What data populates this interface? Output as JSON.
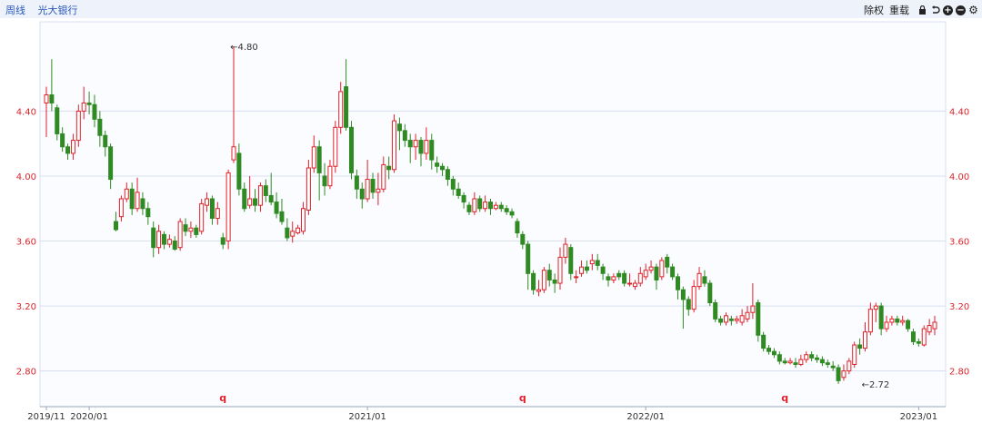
{
  "toolbar": {
    "period": "周线",
    "stock_name": "光大银行",
    "adjust": "除权",
    "overlay": "重载",
    "icons": [
      "lock-icon",
      "undo-icon",
      "zoom-in-icon",
      "zoom-out-icon",
      "gear-icon"
    ]
  },
  "colors": {
    "up": "#e0202a",
    "down": "#2f8a22",
    "grid": "#d7dff0",
    "axis_text": "#d9262c",
    "bg": "#ffffff",
    "plot_bg": "#fbfcff"
  },
  "chart_data": {
    "type": "candlestick",
    "ylim": [
      2.58,
      4.95
    ],
    "yticks": [
      "4.40",
      "4.00",
      "3.60",
      "3.20",
      "2.80"
    ],
    "xticks": [
      {
        "label": "2019/11",
        "index": 0
      },
      {
        "label": "2020/01",
        "index": 8
      },
      {
        "label": "2021/01",
        "index": 60
      },
      {
        "label": "2022/01",
        "index": 112
      },
      {
        "label": "2023/01",
        "index": 163
      }
    ],
    "annotations": [
      {
        "text": "←4.80",
        "index": 34,
        "value": 4.8,
        "pos": "right"
      },
      {
        "text": "←2.72",
        "index": 152,
        "value": 2.72,
        "pos": "right"
      }
    ],
    "markers": [
      {
        "text": "q",
        "index": 33
      },
      {
        "text": "q",
        "index": 89
      },
      {
        "text": "q",
        "index": 138
      }
    ],
    "candles": [
      [
        4.45,
        4.5,
        4.55,
        4.24
      ],
      [
        4.5,
        4.45,
        4.72,
        4.4
      ],
      [
        4.42,
        4.26,
        4.44,
        4.22
      ],
      [
        4.26,
        4.18,
        4.3,
        4.15
      ],
      [
        4.18,
        4.14,
        4.2,
        4.1
      ],
      [
        4.14,
        4.22,
        4.26,
        4.1
      ],
      [
        4.22,
        4.4,
        4.44,
        4.18
      ],
      [
        4.4,
        4.45,
        4.55,
        4.35
      ],
      [
        4.45,
        4.44,
        4.52,
        4.38
      ],
      [
        4.44,
        4.35,
        4.5,
        4.3
      ],
      [
        4.35,
        4.25,
        4.4,
        4.18
      ],
      [
        4.25,
        4.18,
        4.28,
        4.12
      ],
      [
        4.18,
        3.98,
        4.2,
        3.92
      ],
      [
        3.72,
        3.67,
        3.78,
        3.66
      ],
      [
        3.75,
        3.86,
        3.88,
        3.72
      ],
      [
        3.86,
        3.92,
        3.96,
        3.84
      ],
      [
        3.92,
        3.8,
        3.96,
        3.76
      ],
      [
        3.8,
        3.9,
        3.99,
        3.78
      ],
      [
        3.86,
        3.8,
        3.9,
        3.76
      ],
      [
        3.8,
        3.75,
        3.84,
        3.7
      ],
      [
        3.68,
        3.56,
        3.72,
        3.5
      ],
      [
        3.56,
        3.66,
        3.7,
        3.52
      ],
      [
        3.64,
        3.58,
        3.66,
        3.55
      ],
      [
        3.58,
        3.61,
        3.64,
        3.56
      ],
      [
        3.6,
        3.55,
        3.63,
        3.54
      ],
      [
        3.56,
        3.72,
        3.74,
        3.54
      ],
      [
        3.7,
        3.66,
        3.74,
        3.63
      ],
      [
        3.66,
        3.68,
        3.72,
        3.62
      ],
      [
        3.68,
        3.64,
        3.7,
        3.62
      ],
      [
        3.66,
        3.83,
        3.86,
        3.64
      ],
      [
        3.82,
        3.86,
        3.9,
        3.78
      ],
      [
        3.86,
        3.74,
        3.88,
        3.7
      ],
      [
        3.74,
        3.8,
        3.84,
        3.7
      ],
      [
        3.62,
        3.58,
        3.65,
        3.55
      ],
      [
        3.6,
        4.02,
        4.04,
        3.55
      ],
      [
        4.1,
        4.18,
        4.8,
        4.08
      ],
      [
        4.14,
        3.92,
        4.2,
        3.88
      ],
      [
        3.92,
        3.8,
        3.96,
        3.78
      ],
      [
        3.82,
        3.86,
        4.0,
        3.8
      ],
      [
        3.86,
        3.82,
        3.92,
        3.78
      ],
      [
        3.82,
        3.94,
        3.96,
        3.78
      ],
      [
        3.94,
        3.88,
        3.98,
        3.84
      ],
      [
        3.88,
        3.84,
        4.02,
        3.82
      ],
      [
        3.84,
        3.77,
        3.9,
        3.74
      ],
      [
        3.78,
        3.72,
        3.86,
        3.7
      ],
      [
        3.68,
        3.62,
        3.74,
        3.6
      ],
      [
        3.63,
        3.66,
        3.72,
        3.59
      ],
      [
        3.65,
        3.68,
        3.7,
        3.64
      ],
      [
        3.66,
        3.8,
        3.84,
        3.64
      ],
      [
        3.79,
        4.05,
        4.1,
        3.76
      ],
      [
        4.05,
        4.18,
        4.25,
        4.02
      ],
      [
        4.18,
        4.02,
        4.22,
        3.85
      ],
      [
        4.0,
        3.94,
        4.08,
        3.88
      ],
      [
        3.94,
        4.06,
        4.1,
        3.92
      ],
      [
        4.06,
        4.3,
        4.34,
        4.02
      ],
      [
        4.3,
        4.52,
        4.58,
        4.26
      ],
      [
        4.55,
        4.3,
        4.72,
        4.28
      ],
      [
        4.3,
        4.02,
        4.34,
        3.98
      ],
      [
        4.0,
        3.92,
        4.04,
        3.86
      ],
      [
        3.92,
        3.86,
        3.96,
        3.8
      ],
      [
        3.86,
        3.98,
        4.1,
        3.84
      ],
      [
        3.98,
        3.9,
        4.02,
        3.86
      ],
      [
        3.9,
        3.92,
        4.02,
        3.82
      ],
      [
        3.92,
        4.07,
        4.12,
        3.9
      ],
      [
        4.06,
        4.04,
        4.12,
        3.98
      ],
      [
        4.04,
        4.34,
        4.38,
        4.02
      ],
      [
        4.32,
        4.28,
        4.36,
        4.16
      ],
      [
        4.28,
        4.22,
        4.32,
        4.18
      ],
      [
        4.22,
        4.18,
        4.26,
        4.08
      ],
      [
        4.18,
        4.22,
        4.26,
        4.1
      ],
      [
        4.22,
        4.14,
        4.24,
        4.06
      ],
      [
        4.14,
        4.22,
        4.3,
        4.1
      ],
      [
        4.22,
        4.1,
        4.26,
        4.04
      ],
      [
        4.08,
        4.06,
        4.12,
        4.02
      ],
      [
        4.06,
        4.04,
        4.08,
        4.0
      ],
      [
        4.04,
        3.98,
        4.06,
        3.94
      ],
      [
        3.98,
        3.92,
        4.0,
        3.88
      ],
      [
        3.92,
        3.88,
        3.96,
        3.86
      ],
      [
        3.88,
        3.84,
        3.9,
        3.8
      ],
      [
        3.82,
        3.78,
        3.84,
        3.76
      ],
      [
        3.78,
        3.86,
        3.9,
        3.76
      ],
      [
        3.86,
        3.8,
        3.88,
        3.78
      ],
      [
        3.8,
        3.84,
        3.88,
        3.78
      ],
      [
        3.84,
        3.8,
        3.86,
        3.76
      ],
      [
        3.8,
        3.82,
        3.84,
        3.79
      ],
      [
        3.82,
        3.8,
        3.84,
        3.78
      ],
      [
        3.8,
        3.78,
        3.82,
        3.76
      ],
      [
        3.78,
        3.76,
        3.8,
        3.74
      ],
      [
        3.72,
        3.65,
        3.74,
        3.62
      ],
      [
        3.64,
        3.58,
        3.66,
        3.55
      ],
      [
        3.58,
        3.4,
        3.6,
        3.3
      ],
      [
        3.4,
        3.3,
        3.42,
        3.27
      ],
      [
        3.29,
        3.3,
        3.36,
        3.26
      ],
      [
        3.3,
        3.42,
        3.44,
        3.28
      ],
      [
        3.42,
        3.36,
        3.46,
        3.32
      ],
      [
        3.36,
        3.34,
        3.4,
        3.28
      ],
      [
        3.34,
        3.5,
        3.56,
        3.3
      ],
      [
        3.5,
        3.58,
        3.62,
        3.46
      ],
      [
        3.56,
        3.4,
        3.58,
        3.36
      ],
      [
        3.38,
        3.38,
        3.42,
        3.34
      ],
      [
        3.4,
        3.44,
        3.48,
        3.38
      ],
      [
        3.44,
        3.42,
        3.48,
        3.4
      ],
      [
        3.46,
        3.48,
        3.52,
        3.42
      ],
      [
        3.48,
        3.45,
        3.52,
        3.42
      ],
      [
        3.44,
        3.4,
        3.46,
        3.36
      ],
      [
        3.38,
        3.36,
        3.4,
        3.32
      ],
      [
        3.36,
        3.38,
        3.4,
        3.34
      ],
      [
        3.4,
        3.38,
        3.42,
        3.36
      ],
      [
        3.4,
        3.34,
        3.42,
        3.32
      ],
      [
        3.34,
        3.34,
        3.4,
        3.32
      ],
      [
        3.32,
        3.34,
        3.36,
        3.3
      ],
      [
        3.34,
        3.4,
        3.44,
        3.32
      ],
      [
        3.38,
        3.42,
        3.46,
        3.36
      ],
      [
        3.42,
        3.44,
        3.48,
        3.4
      ],
      [
        3.44,
        3.36,
        3.46,
        3.3
      ],
      [
        3.38,
        3.48,
        3.5,
        3.36
      ],
      [
        3.5,
        3.44,
        3.52,
        3.4
      ],
      [
        3.44,
        3.38,
        3.46,
        3.36
      ],
      [
        3.38,
        3.3,
        3.4,
        3.24
      ],
      [
        3.3,
        3.24,
        3.32,
        3.06
      ],
      [
        3.24,
        3.18,
        3.26,
        3.14
      ],
      [
        3.18,
        3.32,
        3.36,
        3.16
      ],
      [
        3.32,
        3.4,
        3.44,
        3.3
      ],
      [
        3.38,
        3.34,
        3.42,
        3.32
      ],
      [
        3.34,
        3.22,
        3.36,
        3.2
      ],
      [
        3.22,
        3.12,
        3.24,
        3.1
      ],
      [
        3.12,
        3.1,
        3.14,
        3.08
      ],
      [
        3.1,
        3.14,
        3.16,
        3.08
      ],
      [
        3.12,
        3.11,
        3.14,
        3.08
      ],
      [
        3.11,
        3.12,
        3.14,
        3.09
      ],
      [
        3.1,
        3.14,
        3.18,
        3.08
      ],
      [
        3.12,
        3.16,
        3.2,
        3.1
      ],
      [
        3.16,
        3.2,
        3.34,
        3.12
      ],
      [
        3.22,
        3.02,
        3.24,
        2.98
      ],
      [
        3.02,
        2.94,
        3.04,
        2.92
      ],
      [
        2.94,
        2.92,
        2.96,
        2.9
      ],
      [
        2.92,
        2.9,
        2.94,
        2.88
      ],
      [
        2.9,
        2.86,
        2.92,
        2.84
      ],
      [
        2.86,
        2.85,
        2.88,
        2.84
      ],
      [
        2.85,
        2.86,
        2.88,
        2.84
      ],
      [
        2.85,
        2.84,
        2.88,
        2.82
      ],
      [
        2.84,
        2.87,
        2.9,
        2.83
      ],
      [
        2.87,
        2.9,
        2.92,
        2.85
      ],
      [
        2.9,
        2.88,
        2.92,
        2.86
      ],
      [
        2.88,
        2.87,
        2.9,
        2.85
      ],
      [
        2.87,
        2.85,
        2.89,
        2.83
      ],
      [
        2.85,
        2.84,
        2.87,
        2.82
      ],
      [
        2.83,
        2.82,
        2.86,
        2.8
      ],
      [
        2.82,
        2.74,
        2.84,
        2.72
      ],
      [
        2.76,
        2.8,
        2.84,
        2.74
      ],
      [
        2.8,
        2.86,
        2.88,
        2.78
      ],
      [
        2.84,
        2.96,
        2.98,
        2.82
      ],
      [
        2.96,
        2.94,
        3.0,
        2.9
      ],
      [
        2.94,
        3.04,
        3.1,
        2.92
      ],
      [
        3.04,
        3.18,
        3.22,
        3.02
      ],
      [
        3.18,
        3.2,
        3.22,
        3.1
      ],
      [
        3.2,
        3.06,
        3.22,
        3.02
      ],
      [
        3.06,
        3.1,
        3.14,
        3.04
      ],
      [
        3.1,
        3.12,
        3.14,
        3.08
      ],
      [
        3.12,
        3.1,
        3.14,
        3.08
      ],
      [
        3.1,
        3.11,
        3.14,
        3.08
      ],
      [
        3.11,
        3.06,
        3.12,
        3.04
      ],
      [
        3.04,
        2.98,
        3.06,
        2.96
      ],
      [
        2.98,
        2.97,
        3.0,
        2.95
      ],
      [
        2.96,
        3.06,
        3.08,
        2.95
      ],
      [
        3.04,
        3.08,
        3.12,
        3.02
      ],
      [
        3.06,
        3.1,
        3.14,
        3.02
      ]
    ]
  }
}
